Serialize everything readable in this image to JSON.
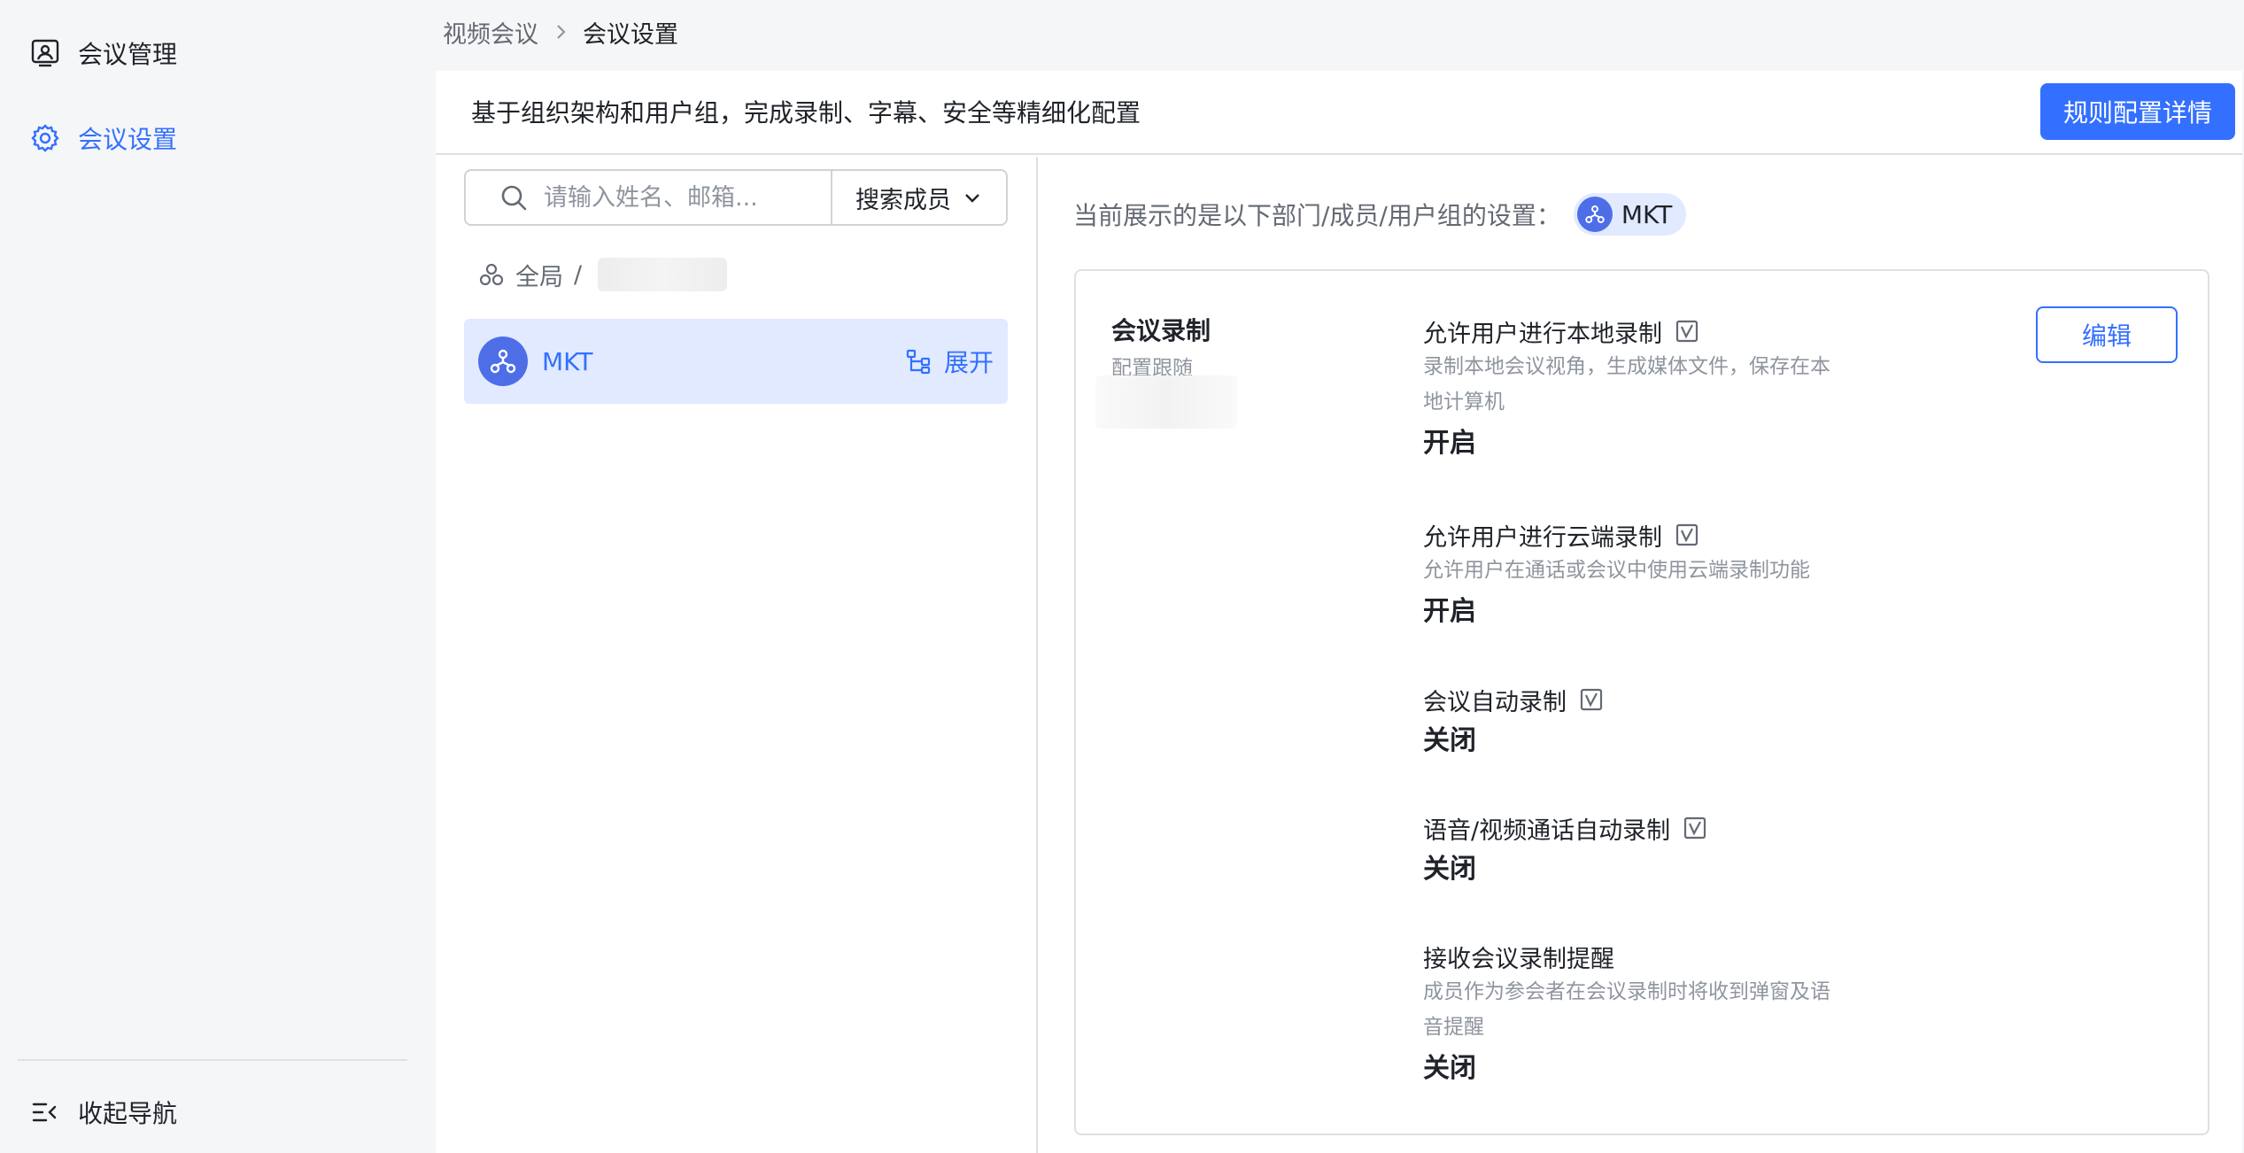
{
  "sidebar": {
    "items": [
      {
        "label": "会议管理",
        "icon": "meeting-manage-icon",
        "active": false
      },
      {
        "label": "会议设置",
        "icon": "gear-icon",
        "active": true
      }
    ],
    "collapse_label": "收起导航"
  },
  "breadcrumb": {
    "parent": "视频会议",
    "current": "会议设置"
  },
  "header": {
    "description": "基于组织架构和用户组，完成录制、字幕、安全等精细化配置",
    "rules_button": "规则配置详情"
  },
  "search": {
    "placeholder": "请输入姓名、邮箱...",
    "scope_label": "搜索成员"
  },
  "tree": {
    "root_label": "全局",
    "separator": "/"
  },
  "department": {
    "name": "MKT",
    "expand_label": "展开"
  },
  "scope": {
    "label": "当前展示的是以下部门/成员/用户组的设置：",
    "chip": "MKT"
  },
  "section": {
    "title": "会议录制",
    "subtitle": "配置跟随",
    "edit_label": "编辑"
  },
  "settings": [
    {
      "name": "允许用户进行本地录制",
      "desc": "录制本地会议视角，生成媒体文件，保存在本地计算机",
      "value": "开启"
    },
    {
      "name": "允许用户进行云端录制",
      "desc": "允许用户在通话或会议中使用云端录制功能",
      "value": "开启"
    },
    {
      "name": "会议自动录制",
      "desc": "",
      "value": "关闭"
    },
    {
      "name": "语音/视频通话自动录制",
      "desc": "",
      "value": "关闭"
    },
    {
      "name": "接收会议录制提醒",
      "desc": "成员作为参会者在会议录制时将收到弹窗及语音提醒",
      "value": "关闭"
    }
  ],
  "colors": {
    "accent": "#3370ff",
    "selected_bg": "#e1eaff",
    "avatar": "#4e6ee8"
  }
}
